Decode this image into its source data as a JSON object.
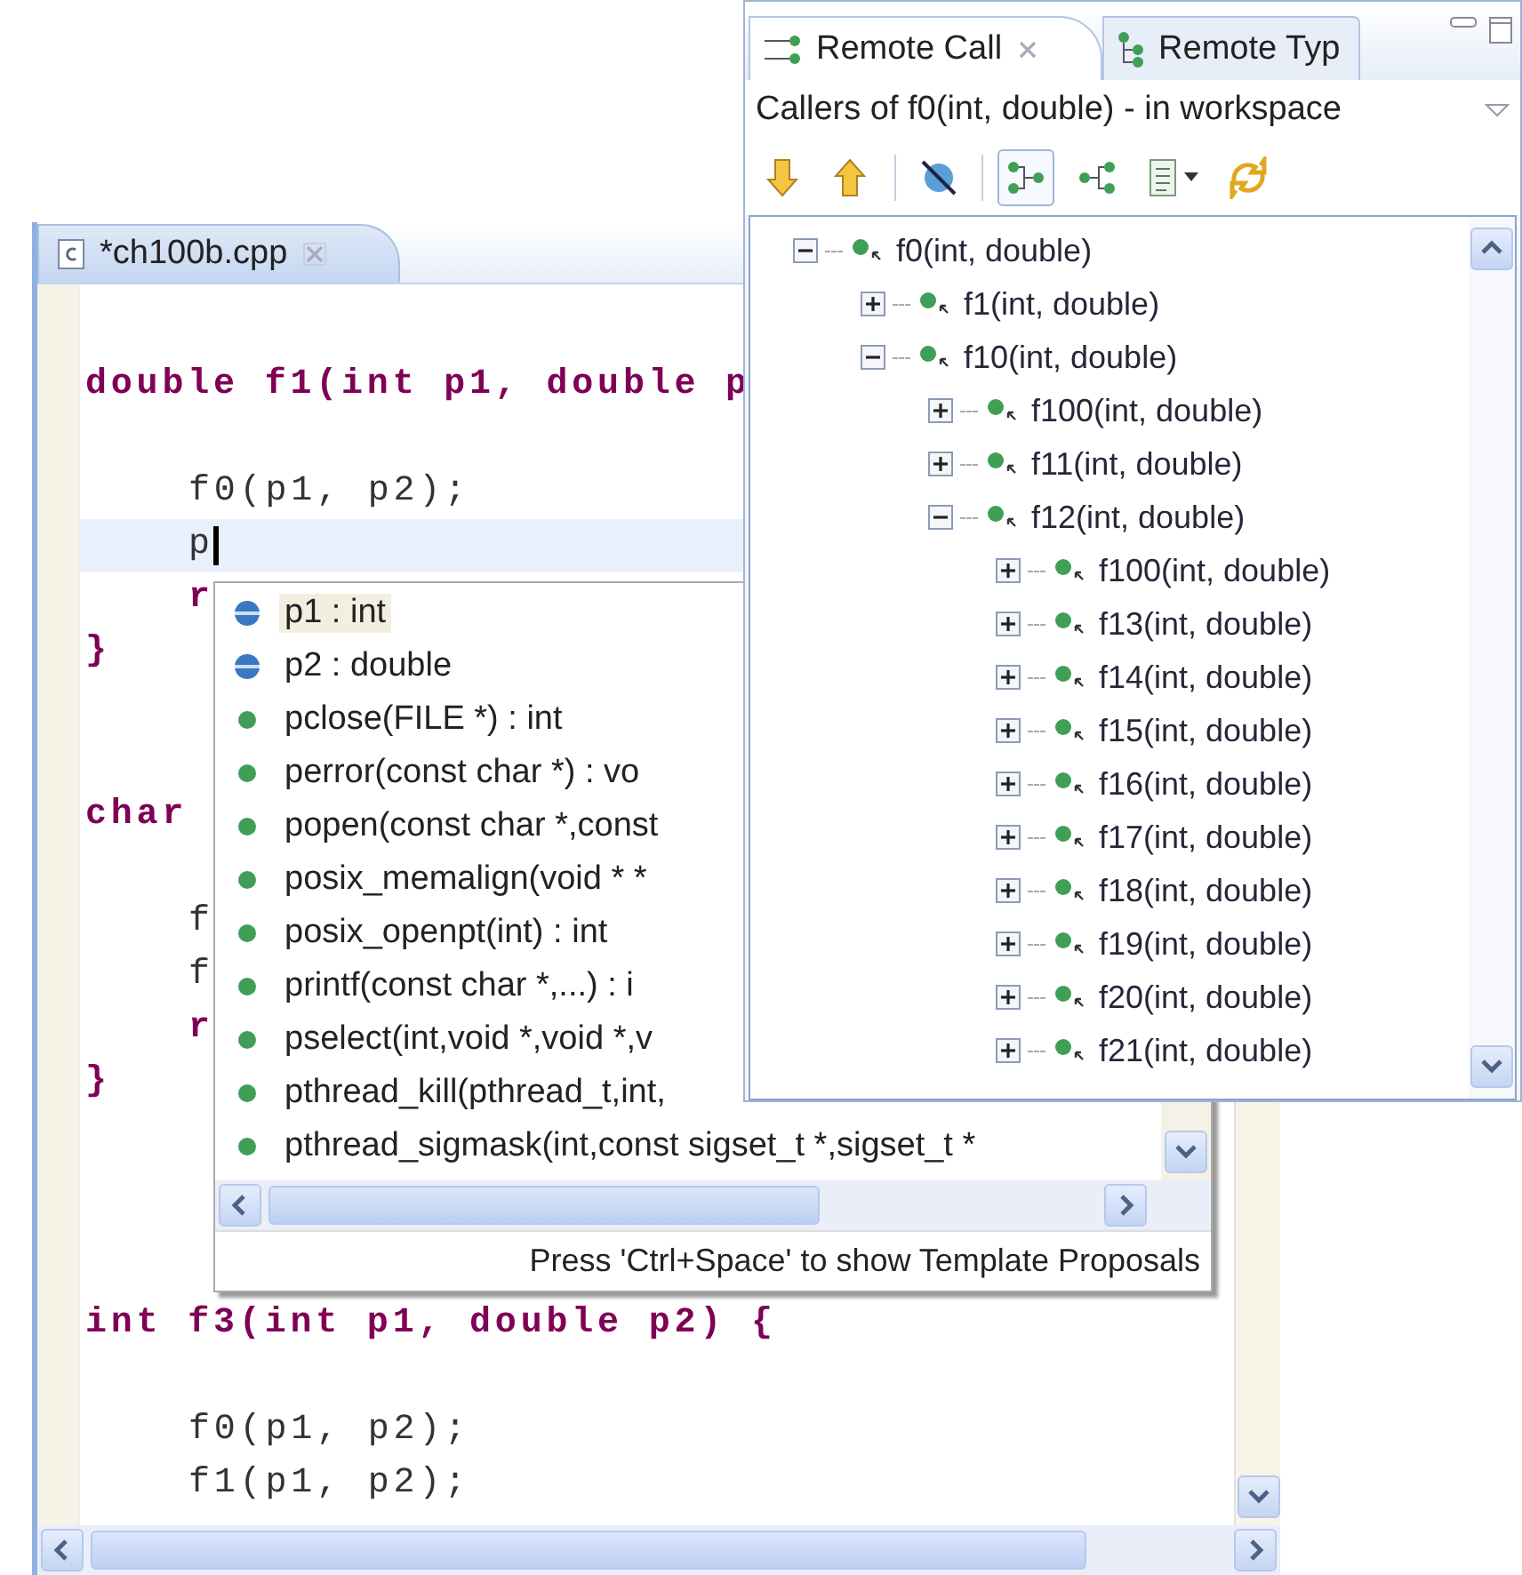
{
  "editor": {
    "tab": {
      "title": "*ch100b.cpp",
      "selected": true
    },
    "functions": [
      {
        "signature": "double f1(int p1, double p",
        "body": [
          {
            "kind": "blank"
          },
          {
            "kind": "statement",
            "text": "f0(p1, p2);",
            "current": false
          },
          {
            "kind": "statement",
            "text": "p",
            "current": true
          },
          {
            "kind": "keyword",
            "text": "r",
            "current": false
          }
        ],
        "closing": "}"
      },
      {
        "signature": "char",
        "body": [
          {
            "kind": "blank"
          },
          {
            "kind": "statement",
            "text": "f",
            "current": false
          },
          {
            "kind": "statement",
            "text": "f",
            "current": false
          },
          {
            "kind": "keyword",
            "text": "r",
            "current": false
          }
        ],
        "closing": "}"
      },
      {
        "signature": "int f3(int p1, double p2) {",
        "body": [
          {
            "kind": "blank"
          },
          {
            "kind": "statement",
            "text": "f0(p1, p2);",
            "current": false
          },
          {
            "kind": "statement",
            "text": "f1(p1, p2);",
            "current": false
          }
        ]
      }
    ]
  },
  "completion_popup": {
    "proposals": [
      {
        "kind": "variable",
        "text": "p1 : int",
        "selected": true
      },
      {
        "kind": "variable",
        "text": "p2 : double",
        "selected": false
      },
      {
        "kind": "function",
        "text": "pclose(FILE *) : int",
        "selected": false
      },
      {
        "kind": "function",
        "text": "perror(const char *) : vo",
        "selected": false
      },
      {
        "kind": "function",
        "text": "popen(const char *,const",
        "selected": false
      },
      {
        "kind": "function",
        "text": "posix_memalign(void * *",
        "selected": false
      },
      {
        "kind": "function",
        "text": "posix_openpt(int) : int",
        "selected": false
      },
      {
        "kind": "function",
        "text": "printf(const char *,...) : i",
        "selected": false
      },
      {
        "kind": "function",
        "text": "pselect(int,void *,void *,v",
        "selected": false
      },
      {
        "kind": "function",
        "text": "pthread_kill(pthread_t,int,",
        "selected": false
      },
      {
        "kind": "function",
        "text": "pthread_sigmask(int,const sigset_t *,sigset_t *",
        "selected": false
      }
    ],
    "hint": "Press 'Ctrl+Space' to show Template Proposals"
  },
  "call_hierarchy_view": {
    "tabs": [
      {
        "label": "Remote Call",
        "selected": true,
        "closable": true
      },
      {
        "label": "Remote Typ",
        "selected": false,
        "closable": false
      }
    ],
    "title": "Callers of f0(int, double) - in workspace",
    "toolbar_toggles": [
      {
        "selected": true
      },
      {
        "selected": false
      }
    ],
    "tree": [
      {
        "label": "f0(int, double)",
        "expanded": true,
        "children": [
          {
            "label": "f1(int, double)",
            "expanded": false
          },
          {
            "label": "f10(int, double)",
            "expanded": true,
            "children": [
              {
                "label": "f100(int, double)",
                "expanded": false
              },
              {
                "label": "f11(int, double)",
                "expanded": false
              },
              {
                "label": "f12(int, double)",
                "expanded": true,
                "children": [
                  {
                    "label": "f100(int, double)",
                    "expanded": false
                  },
                  {
                    "label": "f13(int, double)",
                    "expanded": false
                  },
                  {
                    "label": "f14(int, double)",
                    "expanded": false
                  },
                  {
                    "label": "f15(int, double)",
                    "expanded": false
                  },
                  {
                    "label": "f16(int, double)",
                    "expanded": false
                  },
                  {
                    "label": "f17(int, double)",
                    "expanded": false
                  },
                  {
                    "label": "f18(int, double)",
                    "expanded": false
                  },
                  {
                    "label": "f19(int, double)",
                    "expanded": false
                  },
                  {
                    "label": "f20(int, double)",
                    "expanded": false
                  },
                  {
                    "label": "f21(int, double)",
                    "expanded": false
                  }
                ]
              }
            ]
          }
        ]
      }
    ]
  }
}
